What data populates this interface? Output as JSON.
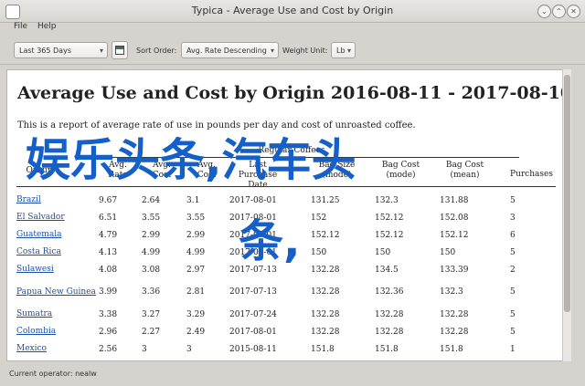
{
  "window": {
    "title": "Typica - Average Use and Cost by Origin"
  },
  "menu": {
    "items": [
      "File",
      "Help"
    ]
  },
  "toolbar": {
    "date_range": "Last 365 Days",
    "sort_order_label": "Sort Order:",
    "sort_order_value": "Avg. Rate Descending",
    "weight_unit_label": "Weight Unit:",
    "weight_unit_value": "Lb"
  },
  "report": {
    "title": "Average Use and Cost by Origin 2016-08-11 - 2017-08-10",
    "description": "This is a report of average rate of use in pounds per day and cost of unroasted coffee.",
    "group_header": "Regular Coffees",
    "columns": [
      "Origin",
      "Avg. Rate",
      "Avg. Cost",
      "Avg. Cost",
      "Last Purchase Date",
      "Bag Size (mode)",
      "Bag Cost (mode)",
      "Bag Cost (mean)",
      "Purchases"
    ],
    "rows": [
      [
        "Brazil",
        "9.67",
        "2.64",
        "3.1",
        "2017-08-01",
        "131.25",
        "132.3",
        "131.88",
        "5"
      ],
      [
        "El Salvador",
        "6.51",
        "3.55",
        "3.55",
        "2017-08-01",
        "152",
        "152.12",
        "152.08",
        "3"
      ],
      [
        "Guatemala",
        "4.79",
        "2.99",
        "2.99",
        "2017-08-01",
        "152.12",
        "152.12",
        "152.12",
        "6"
      ],
      [
        "Costa Rica",
        "4.13",
        "4.99",
        "4.99",
        "2017-08-01",
        "150",
        "150",
        "150",
        "5"
      ],
      [
        "Sulawesi",
        "4.08",
        "3.08",
        "2.97",
        "2017-07-13",
        "132.28",
        "134.5",
        "133.39",
        "2"
      ],
      [
        "Papua New Guinea",
        "3.99",
        "3.36",
        "2.81",
        "2017-07-13",
        "132.28",
        "132.36",
        "132.3",
        "5"
      ],
      [
        "Sumatra",
        "3.38",
        "3.27",
        "3.29",
        "2017-07-24",
        "132.28",
        "132.28",
        "132.28",
        "5"
      ],
      [
        "Colombia",
        "2.96",
        "2.27",
        "2.49",
        "2017-08-01",
        "132.28",
        "132.28",
        "132.28",
        "5"
      ],
      [
        "Mexico",
        "2.56",
        "3",
        "3",
        "2015-08-11",
        "151.8",
        "151.8",
        "151.8",
        "1"
      ]
    ]
  },
  "overlay": {
    "line1": "娱乐头条,汽车头",
    "line2": "条,"
  },
  "status": {
    "text": "Current operator: nealw"
  }
}
